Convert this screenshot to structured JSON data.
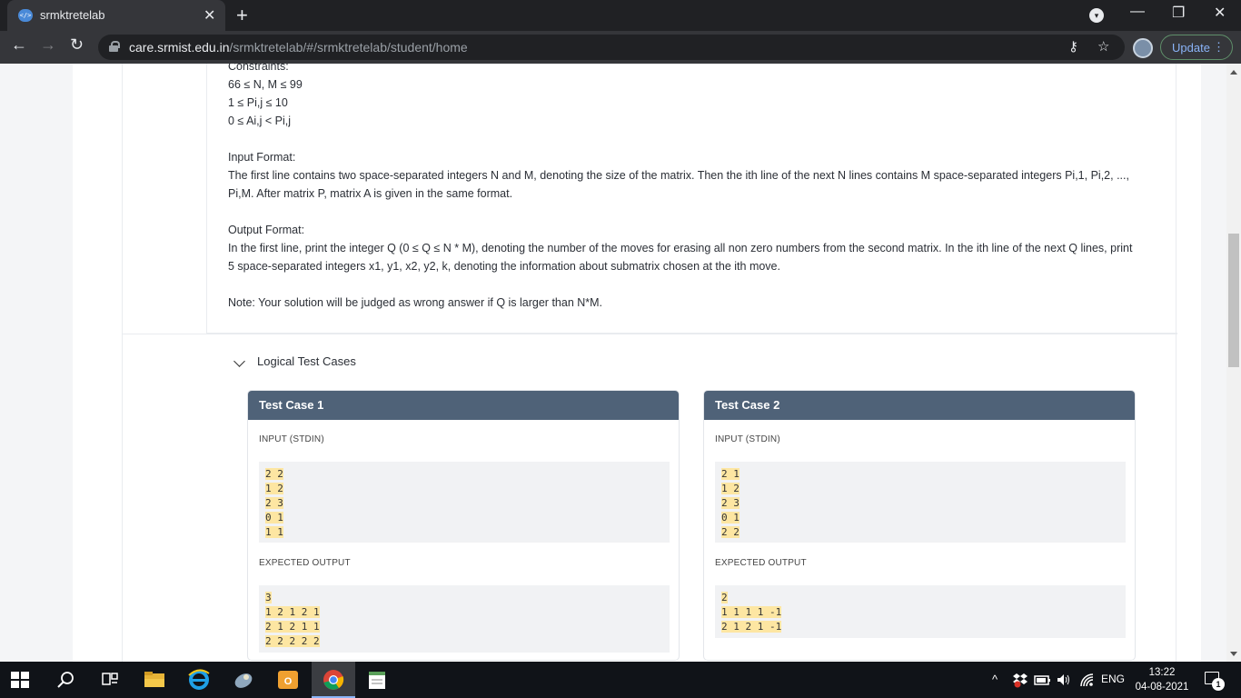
{
  "browser": {
    "tab_title": "srmktretelab",
    "tab_favicon_text": "</>",
    "new_tab_glyph": "+",
    "close_glyph": "✕",
    "url_host": "care.srmist.edu.in",
    "url_path": "/srmktretelab/#/srmktretelab/student/home",
    "update_label": "Update",
    "back_glyph": "←",
    "forward_glyph": "→",
    "reload_glyph": "↻",
    "key_glyph": "⚷",
    "star_glyph": "☆",
    "minimize_glyph": "—",
    "restore_glyph": "❐",
    "window_close_glyph": "✕",
    "menu_glyph": "⋮",
    "profile_glyph": "▾"
  },
  "problem": {
    "constraints_label": "Constraints:",
    "constraints": [
      "66 ≤ N, M ≤ 99",
      "1 ≤ Pi,j ≤ 10",
      "0 ≤ Ai,j < Pi,j"
    ],
    "input_label": "Input Format:",
    "input_text": "The first line contains two space-separated integers N and M, denoting the size of the matrix. Then the ith line of the next N lines contains M space-separated integers Pi,1, Pi,2, ..., Pi,M. After matrix P, matrix A is given in the same format.",
    "output_label": "Output Format:",
    "output_text": "In the first line, print the integer Q (0 ≤ Q ≤ N * M), denoting the number of the moves for erasing all non zero numbers from the second matrix. In the ith line of the next Q lines, print 5 space-separated integers x1, y1, x2, y2, k, denoting the information about submatrix chosen at the ith move.",
    "note": "Note: Your solution will be judged as wrong answer if Q is larger than N*M."
  },
  "test_cases": {
    "section_label": "Logical Test Cases",
    "input_label": "INPUT (STDIN)",
    "output_label": "EXPECTED OUTPUT",
    "case1": {
      "title": "Test Case 1",
      "input": [
        "2 2",
        "1 2",
        "2 3",
        "0 1",
        "1 1"
      ],
      "output": [
        "3",
        "1 2 1 2 1",
        "2 1 2 1 1",
        "2 2 2 2 2"
      ]
    },
    "case2": {
      "title": "Test Case 2",
      "input": [
        "2 1",
        "1 2",
        "2 3",
        "0 1",
        "2 2"
      ],
      "output": [
        "2",
        "1 1 1 1 -1",
        "2 1 2 1 -1"
      ]
    }
  },
  "taskbar": {
    "time": "13:22",
    "date": "04-08-2021",
    "language": "ENG",
    "notification_count": "1",
    "tray_chevron": "^"
  },
  "colors": {
    "test_case_header": "#4f6278",
    "code_highlight": "#fde6a2",
    "chrome_dark": "#202124"
  }
}
